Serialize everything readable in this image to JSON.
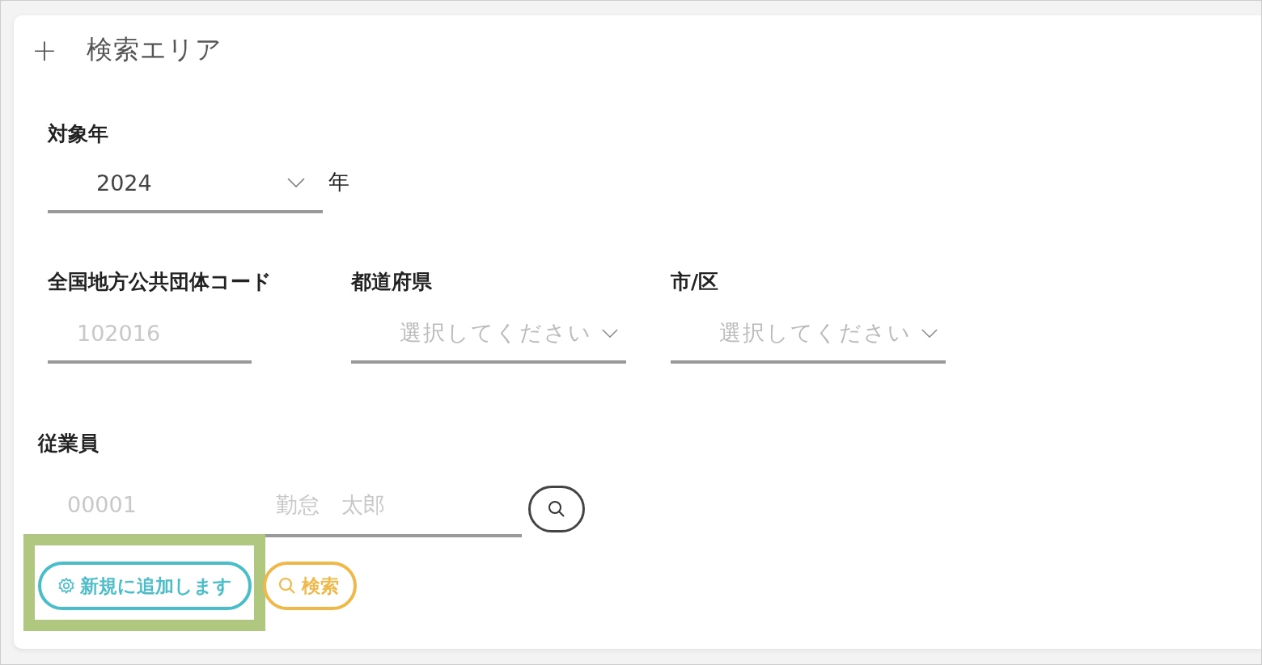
{
  "panel": {
    "expand_icon": "+",
    "title": "検索エリア"
  },
  "year": {
    "label": "対象年",
    "value": "2024",
    "unit": "年"
  },
  "filters": [
    {
      "kind": "input",
      "label": "全国地方公共団体コード",
      "placeholder": "102016"
    },
    {
      "kind": "select",
      "label": "都道府県",
      "placeholder": "選択してください"
    },
    {
      "kind": "select",
      "label": "市/区",
      "placeholder": "選択してください"
    }
  ],
  "employee": {
    "label": "従業員",
    "code_placeholder": "00001",
    "name_placeholder": "勤怠　太郎"
  },
  "buttons": [
    {
      "kind": "add",
      "label": "新規に追加します",
      "highlighted": true
    },
    {
      "kind": "search",
      "label": "検索",
      "highlighted": false
    }
  ]
}
